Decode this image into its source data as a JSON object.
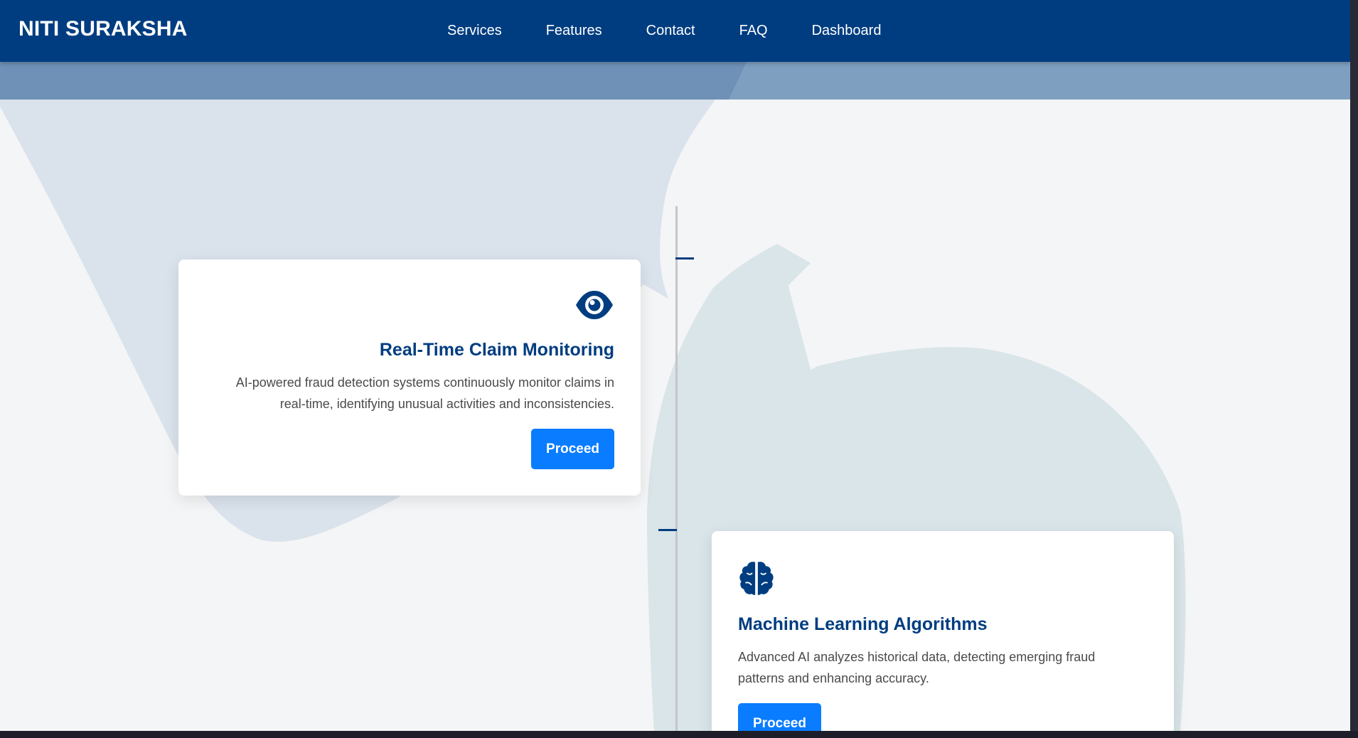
{
  "navbar": {
    "brand": "NITI SURAKSHA",
    "links": [
      "Services",
      "Features",
      "Contact",
      "FAQ",
      "Dashboard"
    ]
  },
  "cards": [
    {
      "title": "Real-Time Claim Monitoring",
      "description_line1": "AI-powered fraud detection systems continuously monitor claims in",
      "description_line2": "real-time, identifying unusual activities and inconsistencies.",
      "button": "Proceed",
      "icon": "eye-icon"
    },
    {
      "title": "Machine Learning Algorithms",
      "description_line1": "Advanced AI analyzes historical data, detecting emerging fraud",
      "description_line2": "patterns and enhancing accuracy.",
      "button": "Proceed",
      "icon": "brain-icon"
    }
  ],
  "colors": {
    "navbar": "#003d80",
    "accent": "#0a7cff",
    "title": "#003d80",
    "page_background": "#f4f5f6"
  }
}
